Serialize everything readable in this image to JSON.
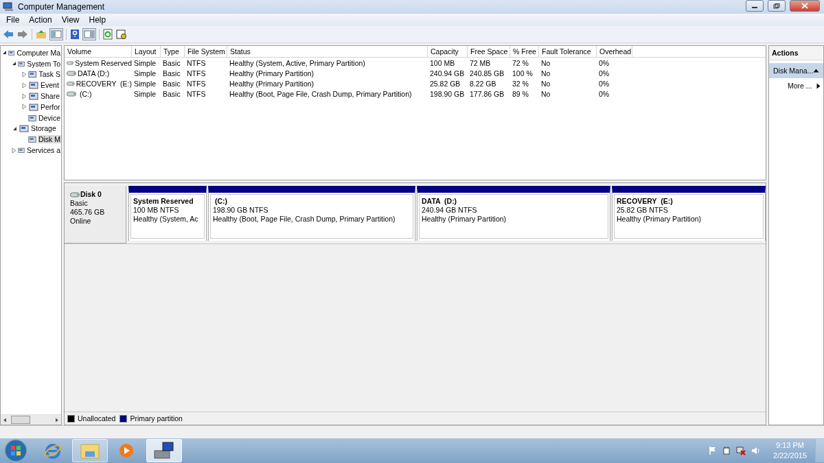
{
  "window": {
    "title": "Computer Management"
  },
  "menu": [
    "File",
    "Action",
    "View",
    "Help"
  ],
  "tree": [
    {
      "label": "Computer Ma",
      "expanded": true,
      "selected": false,
      "children": [
        {
          "label": "System To",
          "expanded": true,
          "selected": false,
          "children": [
            {
              "label": "Task S",
              "expanded": false,
              "selected": false
            },
            {
              "label": "Event",
              "expanded": false,
              "selected": false
            },
            {
              "label": "Share",
              "expanded": false,
              "selected": false
            },
            {
              "label": "Perfor",
              "expanded": false,
              "selected": false
            },
            {
              "label": "Device",
              "selected": false
            }
          ]
        },
        {
          "label": "Storage",
          "expanded": true,
          "selected": false,
          "children": [
            {
              "label": "Disk M",
              "selected": true
            }
          ]
        },
        {
          "label": "Services a",
          "expanded": false,
          "selected": false
        }
      ]
    }
  ],
  "volumes": {
    "columns": [
      "Volume",
      "Layout",
      "Type",
      "File System",
      "Status",
      "Capacity",
      "Free Space",
      "% Free",
      "Fault Tolerance",
      "Overhead"
    ],
    "rows": [
      [
        "System Reserved",
        "Simple",
        "Basic",
        "NTFS",
        "Healthy (System, Active, Primary Partition)",
        "100 MB",
        "72 MB",
        "72 %",
        "No",
        "0%"
      ],
      [
        "DATA (D:)",
        "Simple",
        "Basic",
        "NTFS",
        "Healthy (Primary Partition)",
        "240.94 GB",
        "240.85 GB",
        "100 %",
        "No",
        "0%"
      ],
      [
        "RECOVERY  (E:)",
        "Simple",
        "Basic",
        "NTFS",
        "Healthy (Primary Partition)",
        "25.82 GB",
        "8.22 GB",
        "32 %",
        "No",
        "0%"
      ],
      [
        " (C:)",
        "Simple",
        "Basic",
        "NTFS",
        "Healthy (Boot, Page File, Crash Dump, Primary Partition)",
        "198.90 GB",
        "177.86 GB",
        "89 %",
        "No",
        "0%"
      ]
    ]
  },
  "disk": {
    "name": "Disk 0",
    "type": "Basic",
    "size": "465.76 GB",
    "state": "Online",
    "partitions": [
      {
        "name": "System Reserved",
        "size": "100 MB NTFS",
        "status": "Healthy (System, Ac"
      },
      {
        "name": " (C:)",
        "size": "198.90 GB NTFS",
        "status": "Healthy (Boot, Page File, Crash Dump, Primary Partition)"
      },
      {
        "name": "DATA  (D:)",
        "size": "240.94 GB NTFS",
        "status": "Healthy (Primary Partition)"
      },
      {
        "name": "RECOVERY  (E:)",
        "size": "25.82 GB NTFS",
        "status": "Healthy (Primary Partition)"
      }
    ]
  },
  "legend": [
    {
      "label": "Unallocated",
      "color": "#000000"
    },
    {
      "label": "Primary partition",
      "color": "#000080"
    }
  ],
  "actions": {
    "title": "Actions",
    "section": "Disk Mana...",
    "items": [
      "More ..."
    ]
  },
  "tray": {
    "time": "9:13 PM",
    "date": "2/22/2015"
  }
}
